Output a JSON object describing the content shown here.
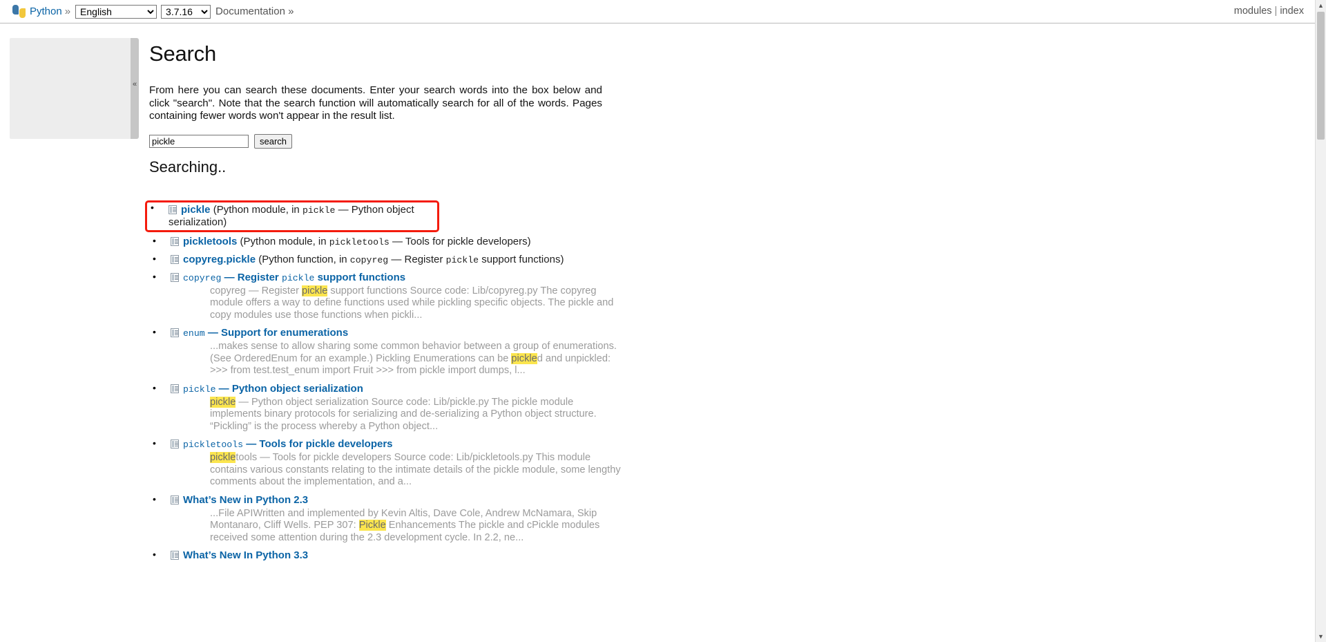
{
  "header": {
    "logo_icon": "python-logo-icon",
    "brand": "Python",
    "brand_sep": "»",
    "language_selected": "English",
    "language_options": [
      "English"
    ],
    "version_selected": "3.7.16",
    "version_options": [
      "3.7.16"
    ],
    "documentation_label": "Documentation »",
    "right_links": {
      "modules": "modules",
      "divider": "|",
      "index": "index"
    }
  },
  "sidebar": {
    "collapse_handle_glyph": "«"
  },
  "main": {
    "page_title": "Search",
    "intro": "From here you can search these documents. Enter your search words into the box below and click \"search\". Note that the search function will automatically search for all of the words. Pages containing fewer words won't appear in the result list.",
    "search": {
      "value": "pickle",
      "placeholder": "",
      "button_label": "search"
    },
    "status_heading": "Searching..",
    "results": [
      {
        "icon": "document-icon",
        "title_plain": "pickle",
        "title_mono": "",
        "title_suffix": "",
        "context_prefix": "(Python module, in ",
        "context_mono": "pickle",
        "context_suffix": " — Python object serialization)",
        "snippet_parts": [],
        "highlighted": true
      },
      {
        "icon": "document-icon",
        "title_plain": "pickletools",
        "title_mono": "",
        "title_suffix": "",
        "context_prefix": "(Python module, in ",
        "context_mono": "pickletools",
        "context_suffix": " — Tools for pickle developers)",
        "snippet_parts": [],
        "highlighted": false
      },
      {
        "icon": "document-icon",
        "title_plain": "copyreg.pickle",
        "title_mono": "",
        "title_suffix": "",
        "context_prefix": "(Python function, in ",
        "context_mono": "copyreg",
        "context_suffix": " — Register ",
        "context_mono2": "pickle",
        "context_suffix2": " support functions)",
        "snippet_parts": [],
        "highlighted": false
      },
      {
        "icon": "document-icon",
        "title_mono": "copyreg",
        "title_plain": " — Register ",
        "title_mono2": "pickle",
        "title_suffix": " support functions",
        "snippet_parts": [
          {
            "text": "copyreg — Register ",
            "hl": false
          },
          {
            "text": "pickle",
            "hl": true
          },
          {
            "text": " support functions Source code: Lib/copyreg.py The copyreg module offers a way to define functions used while pickling specific objects. The pickle and copy modules use those functions when pickli...",
            "hl": false
          }
        ],
        "highlighted": false
      },
      {
        "icon": "document-icon",
        "title_mono": "enum",
        "title_plain": " — Support for enumerations",
        "title_mono2": "",
        "title_suffix": "",
        "snippet_parts": [
          {
            "text": "...makes sense to allow sharing some common behavior between a group of enumerations. (See OrderedEnum for an example.) Pickling Enumerations can be ",
            "hl": false
          },
          {
            "text": "pickle",
            "hl": true
          },
          {
            "text": "d and unpickled: >>> from test.test_enum import Fruit >>> from pickle import dumps, l...",
            "hl": false
          }
        ],
        "highlighted": false
      },
      {
        "icon": "document-icon",
        "title_mono": "pickle",
        "title_plain": " — Python object serialization",
        "title_mono2": "",
        "title_suffix": "",
        "snippet_parts": [
          {
            "text": "pickle",
            "hl": true
          },
          {
            "text": " — Python object serialization Source code: Lib/pickle.py The pickle module implements binary protocols for serializing and de-serializing a Python object structure. “Pickling” is the process whereby a Python object...",
            "hl": false
          }
        ],
        "highlighted": false
      },
      {
        "icon": "document-icon",
        "title_mono": "pickletools",
        "title_plain": " — Tools for pickle developers",
        "title_mono2": "",
        "title_suffix": "",
        "snippet_parts": [
          {
            "text": "pickle",
            "hl": true
          },
          {
            "text": "tools — Tools for pickle developers Source code: Lib/pickletools.py This module contains various constants relating to the intimate details of the pickle module, some lengthy comments about the implementation, and a...",
            "hl": false
          }
        ],
        "highlighted": false
      },
      {
        "icon": "document-icon",
        "title_mono": "",
        "title_plain": "What’s New in Python 2.3",
        "title_mono2": "",
        "title_suffix": "",
        "snippet_parts": [
          {
            "text": "...File APIWritten and implemented by Kevin Altis, Dave Cole, Andrew McNamara, Skip Montanaro, Cliff Wells. PEP 307: ",
            "hl": false
          },
          {
            "text": "Pickle",
            "hl": true
          },
          {
            "text": " Enhancements The pickle and cPickle modules received some attention during the 2.3 development cycle. In 2.2, ne...",
            "hl": false
          }
        ],
        "highlighted": false
      },
      {
        "icon": "document-icon",
        "title_mono": "",
        "title_plain": "What’s New In Python 3.3",
        "title_mono2": "",
        "title_suffix": "",
        "snippet_parts": [],
        "highlighted": false
      }
    ]
  },
  "scrollbar": {
    "up_arrow": "▲",
    "down_arrow": "▼"
  },
  "colors": {
    "link": "#0b64a6",
    "highlight_bg": "#fbe54e",
    "focus_outline": "#f41b0c",
    "sidebar_bg": "#ededed"
  }
}
